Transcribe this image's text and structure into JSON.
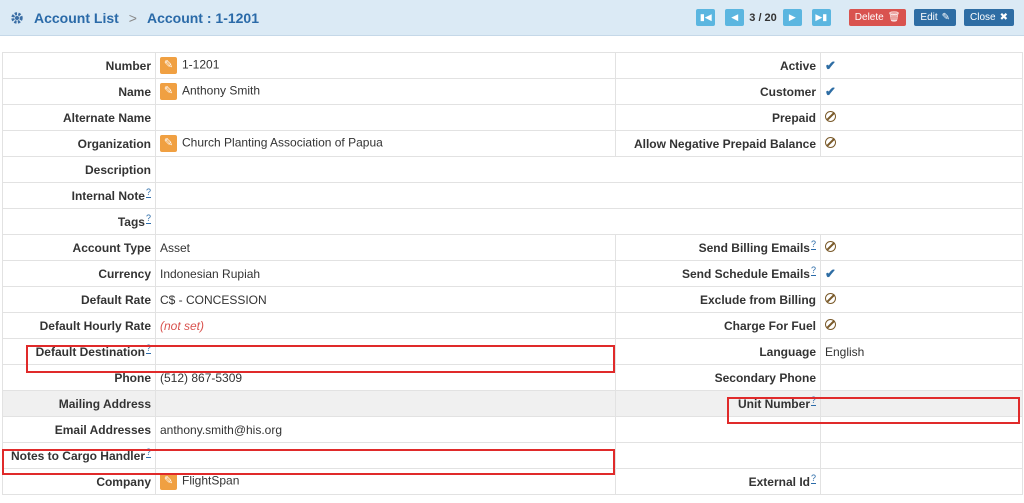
{
  "header": {
    "crumb1": "Account List",
    "separator": ">",
    "crumb2": "Account : 1-1201",
    "pager": "3 / 20",
    "delete_label": "Delete",
    "edit_label": "Edit",
    "close_label": "Close"
  },
  "left": {
    "number": {
      "label": "Number",
      "value": "1-1201"
    },
    "name": {
      "label": "Name",
      "value": "Anthony Smith"
    },
    "alternate_name": {
      "label": "Alternate Name",
      "value": ""
    },
    "organization": {
      "label": "Organization",
      "value": "Church Planting Association of Papua"
    },
    "description": {
      "label": "Description",
      "value": ""
    },
    "internal_note": {
      "label": "Internal Note",
      "value": ""
    },
    "tags": {
      "label": "Tags",
      "value": ""
    },
    "account_type": {
      "label": "Account Type",
      "value": "Asset"
    },
    "currency": {
      "label": "Currency",
      "value": "Indonesian Rupiah"
    },
    "default_rate": {
      "label": "Default Rate",
      "value": "C$ - CONCESSION"
    },
    "default_hourly_rate": {
      "label": "Default Hourly Rate",
      "value": "(not set)"
    },
    "default_destination": {
      "label": "Default Destination",
      "value": ""
    },
    "phone": {
      "label": "Phone",
      "value": "(512) 867-5309"
    },
    "mailing_address": {
      "label": "Mailing Address",
      "value": ""
    },
    "email_addresses": {
      "label": "Email Addresses",
      "value": "anthony.smith@his.org"
    },
    "notes_to_cargo_handler": {
      "label": "Notes to Cargo Handler",
      "value": ""
    },
    "company": {
      "label": "Company",
      "value": "FlightSpan"
    }
  },
  "right": {
    "active": {
      "label": "Active",
      "state": "yes"
    },
    "customer": {
      "label": "Customer",
      "state": "yes"
    },
    "prepaid": {
      "label": "Prepaid",
      "state": "no"
    },
    "allow_negative": {
      "label": "Allow Negative Prepaid Balance",
      "state": "no"
    },
    "send_billing_emails": {
      "label": "Send Billing Emails",
      "state": "no"
    },
    "send_schedule_emails": {
      "label": "Send Schedule Emails",
      "state": "yes"
    },
    "exclude_from_billing": {
      "label": "Exclude from Billing",
      "state": "no"
    },
    "charge_for_fuel": {
      "label": "Charge For Fuel",
      "state": "no"
    },
    "language": {
      "label": "Language",
      "value": "English"
    },
    "secondary_phone": {
      "label": "Secondary Phone",
      "value": ""
    },
    "unit_number": {
      "label": "Unit Number",
      "value": ""
    },
    "external_id": {
      "label": "External Id",
      "value": ""
    }
  },
  "help_glyph": "?",
  "colors": {
    "highlight": "#e02a2a",
    "link": "#2a6aa8",
    "pencil": "#f0a042",
    "delete": "#d9534f",
    "primary": "#2e6da4"
  }
}
